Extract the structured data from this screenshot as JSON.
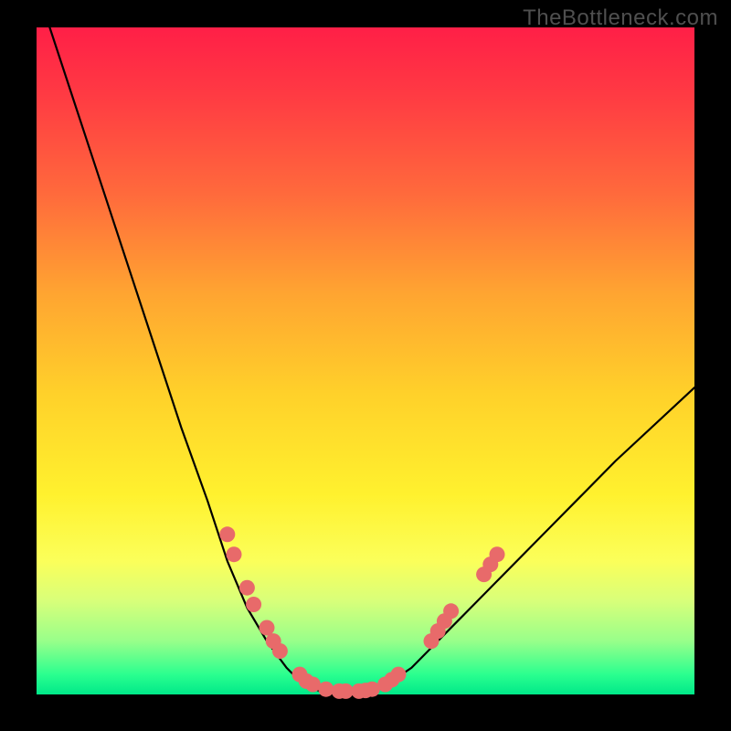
{
  "watermark": "TheBottleneck.com",
  "colors": {
    "frame": "#000000",
    "gradient_top": "#ff1f47",
    "gradient_bottom": "#00e989",
    "curve": "#000000",
    "dot": "#e86a6a"
  },
  "chart_data": {
    "type": "line",
    "title": "",
    "xlabel": "",
    "ylabel": "",
    "xlim": [
      0,
      100
    ],
    "ylim": [
      0,
      100
    ],
    "series": [
      {
        "name": "bottleneck-curve",
        "x": [
          2,
          6,
          10,
          14,
          18,
          22,
          26,
          29,
          32,
          35,
          38,
          40,
          42,
          44,
          46,
          48,
          50,
          52,
          54,
          57,
          60,
          64,
          70,
          78,
          88,
          100
        ],
        "y": [
          100,
          88,
          76,
          64,
          52,
          40,
          29,
          20,
          13,
          8,
          4,
          2,
          1,
          0,
          0,
          0,
          0,
          1,
          2,
          4,
          7,
          11,
          17,
          25,
          35,
          46
        ]
      }
    ],
    "markers": [
      {
        "x": 29,
        "y": 24
      },
      {
        "x": 30,
        "y": 21
      },
      {
        "x": 32,
        "y": 16
      },
      {
        "x": 33,
        "y": 13.5
      },
      {
        "x": 35,
        "y": 10
      },
      {
        "x": 36,
        "y": 8
      },
      {
        "x": 37,
        "y": 6.5
      },
      {
        "x": 40,
        "y": 3
      },
      {
        "x": 41,
        "y": 2
      },
      {
        "x": 42,
        "y": 1.5
      },
      {
        "x": 44,
        "y": 0.8
      },
      {
        "x": 46,
        "y": 0.5
      },
      {
        "x": 47,
        "y": 0.5
      },
      {
        "x": 49,
        "y": 0.5
      },
      {
        "x": 50,
        "y": 0.6
      },
      {
        "x": 51,
        "y": 0.8
      },
      {
        "x": 53,
        "y": 1.5
      },
      {
        "x": 54,
        "y": 2.2
      },
      {
        "x": 55,
        "y": 3
      },
      {
        "x": 60,
        "y": 8
      },
      {
        "x": 61,
        "y": 9.5
      },
      {
        "x": 62,
        "y": 11
      },
      {
        "x": 63,
        "y": 12.5
      },
      {
        "x": 68,
        "y": 18
      },
      {
        "x": 69,
        "y": 19.5
      },
      {
        "x": 70,
        "y": 21
      }
    ]
  }
}
